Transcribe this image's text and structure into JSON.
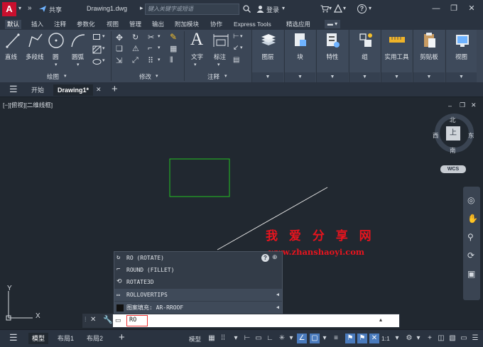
{
  "titlebar": {
    "app_logo": "A",
    "share": "共享",
    "doc_title": "Drawing1.dwg",
    "search_placeholder": "键入关键字或短语",
    "login": "登录",
    "help": "?"
  },
  "ribbon_tabs": [
    "默认",
    "插入",
    "注释",
    "参数化",
    "视图",
    "管理",
    "输出",
    "附加模块",
    "协作",
    "Express Tools",
    "精选应用"
  ],
  "ribbon": {
    "draw_tools": [
      "直线",
      "多段线",
      "圆",
      "圆弧"
    ],
    "draw_group": "绘图",
    "modify_group": "修改",
    "text_tool": "文字",
    "dimension_tool": "标注",
    "annotation_group": "注释",
    "panels": [
      "图层",
      "块",
      "特性",
      "组",
      "实用工具",
      "剪贴板",
      "视图"
    ]
  },
  "doc_tabs": {
    "start": "开始",
    "active": "Drawing1*"
  },
  "viewport_label": "[−][俯视][二维线框]",
  "viewcube": {
    "north": "北",
    "south": "南",
    "east": "东",
    "west": "西",
    "face": "上",
    "wcs": "WCS"
  },
  "axis": {
    "x": "X",
    "y": "Y"
  },
  "watermark": {
    "chinese": "我 爱 分 享 网",
    "url": "www.zhanshaoyi.com"
  },
  "autocomplete": [
    {
      "text": "RO (ROTATE)",
      "sep": false,
      "arrow": false
    },
    {
      "text": "ROUND (FILLET)",
      "sep": false,
      "arrow": false
    },
    {
      "text": "ROTATE3D",
      "sep": false,
      "arrow": false
    },
    {
      "text": "ROLLOVERTIPS",
      "sep": true,
      "arrow": true
    },
    {
      "text": "图案填充: AR-RROOF",
      "sep": true,
      "arrow": true
    }
  ],
  "command_input": "RO",
  "status": {
    "model_tab": "模型",
    "layout1": "布局1",
    "layout2": "布局2",
    "model_space": "模型",
    "scale": "1:1"
  },
  "colors": {
    "rectangle": "#22c222",
    "line": "#e6e6e6",
    "accent": "#4a7bbd",
    "watermark": "#e8141e"
  }
}
